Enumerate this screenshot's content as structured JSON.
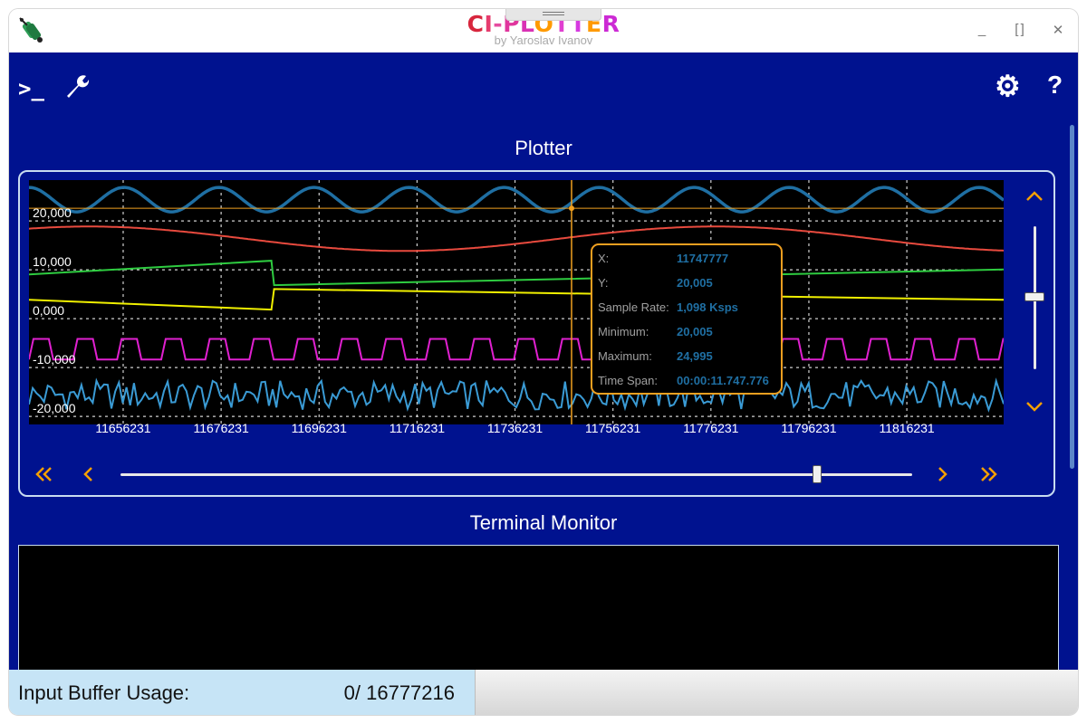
{
  "window": {
    "title_letters": [
      {
        "ch": "C",
        "color": "#d7263d"
      },
      {
        "ch": "I",
        "color": "#e63c6e"
      },
      {
        "ch": "-",
        "color": "#e64ca0"
      },
      {
        "ch": "P",
        "color": "#e0359d"
      },
      {
        "ch": "L",
        "color": "#d931b4"
      },
      {
        "ch": "O",
        "color": "#ff9a00"
      },
      {
        "ch": "T",
        "color": "#e03fd0"
      },
      {
        "ch": "T",
        "color": "#d63ae0"
      },
      {
        "ch": "E",
        "color": "#ff9a00"
      },
      {
        "ch": "R",
        "color": "#cc2ad4"
      }
    ],
    "subtitle": "by Yaroslav Ivanov",
    "minimize_glyph": "_",
    "maximize_glyph": "[ ]",
    "close_glyph": "✕"
  },
  "toolbar": {
    "terminal_icon": ">_",
    "settings_icon": "⚙",
    "help_icon": "?"
  },
  "plotter": {
    "title": "Plotter",
    "progress_fraction": 0.88,
    "vertical_fraction": 0.5,
    "nav_first": "«",
    "nav_prev": "‹",
    "nav_next": "›",
    "nav_last": "»",
    "scale_up": "⌃",
    "scale_down": "⌄"
  },
  "terminal": {
    "title": "Terminal Monitor"
  },
  "footer": {
    "buffer_label": "Input Buffer Usage:",
    "buffer_value": "0/ 16777216",
    "buffer_fraction": 0
  },
  "chart_data": {
    "type": "line",
    "background": "#000000",
    "grid": true,
    "y_tick_labels": [
      "20,000",
      "10,000",
      "0,000",
      "-10,000",
      "-20,000"
    ],
    "y_tick_values": [
      20000,
      10000,
      0,
      -10000,
      -20000
    ],
    "x_tick_labels": [
      "11656231",
      "11676231",
      "11696231",
      "11716231",
      "11736231",
      "11756231",
      "11776231",
      "11796231",
      "11816231"
    ],
    "x_tick_values": [
      11656231,
      11676231,
      11696231,
      11716231,
      11736231,
      11756231,
      11776231,
      11796231,
      11816231
    ],
    "xlim": [
      11637000,
      11836000
    ],
    "ylim": [
      -23500,
      26500
    ],
    "cursor_x": 11747777,
    "cursor_y": 20005,
    "series": [
      {
        "color": "#1f6fa3",
        "shape": "sine",
        "center": 22500,
        "amplitude": 2500,
        "period": 19400,
        "phase": 0.0
      },
      {
        "color": "#e84a3e",
        "shape": "sine",
        "center": 14500,
        "amplitude": 2500,
        "period": 128000,
        "phase": -0.6
      },
      {
        "color": "#2ecc40",
        "shape": "saw",
        "start": 7200,
        "end": 10000,
        "reset_x": 11686500,
        "reset_to": 5000,
        "end2": 8200
      },
      {
        "color": "#f0f000",
        "shape": "saw",
        "start": 2000,
        "end": 0,
        "reset_x": 11686500,
        "reset_to": 4200,
        "end2": 2000
      },
      {
        "color": "#e020d0",
        "shape": "square",
        "high": -6000,
        "low": -10200,
        "period": 9000
      },
      {
        "color": "#3a9bd5",
        "shape": "noise",
        "center": -17500,
        "amplitude": 3000
      }
    ],
    "tooltip": [
      {
        "label": "X:",
        "value": "11747777"
      },
      {
        "label": "Y:",
        "value": "20,005"
      },
      {
        "label": "Sample Rate:",
        "value": "1,098 Ksps"
      },
      {
        "label": "Minimum:",
        "value": "20,005"
      },
      {
        "label": "Maximum:",
        "value": "24,995"
      },
      {
        "label": "Time Span:",
        "value": "00:00:11.747.776"
      }
    ],
    "tooltip_border": "#f0a020",
    "tooltip_value_color": "#1f6fa3"
  }
}
